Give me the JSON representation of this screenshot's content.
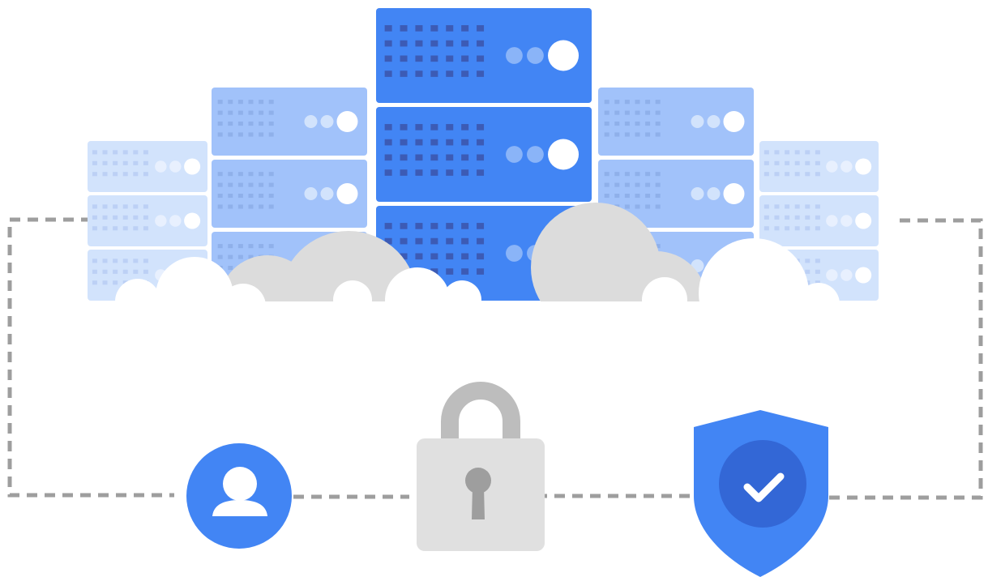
{
  "colors": {
    "background": "#ffffff",
    "server_primary": "#4285f4",
    "server_primary_dot": "#3c5bb5",
    "server_primary_led": "#8ab4f8",
    "server_mid": "#a1c2fa",
    "server_mid_dot": "#8fb0ea",
    "server_mid_led": "#d2e3fc",
    "server_light": "#d2e3fc",
    "server_light_dot": "#bcd0f5",
    "server_light_led": "#e8f0fe",
    "cloud": "#dcdcdc",
    "cloud_white": "#ffffff",
    "connector": "#9e9e9e",
    "lock_body": "#e0e0e0",
    "lock_shackle": "#bdbdbd",
    "keyhole": "#9e9e9e",
    "user_badge": "#4285f4",
    "shield": "#4285f4",
    "shield_inner": "#3367d6",
    "check": "#ffffff"
  },
  "icons": {
    "user": "user-avatar-icon",
    "lock": "padlock-icon",
    "shield": "shield-check-icon",
    "servers": "server-rack-icon",
    "clouds": "cloud-icon"
  },
  "diagram": {
    "server_stacks": [
      {
        "tier": "light",
        "units": 3
      },
      {
        "tier": "mid",
        "units": 3
      },
      {
        "tier": "primary",
        "units": 3
      },
      {
        "tier": "mid",
        "units": 3
      },
      {
        "tier": "light",
        "units": 3
      }
    ],
    "nodes": [
      "user",
      "lock",
      "shield"
    ],
    "connections": [
      {
        "from": "user",
        "to": "lock",
        "style": "dashed"
      },
      {
        "from": "lock",
        "to": "shield",
        "style": "dashed"
      },
      {
        "from": "user",
        "to": "servers",
        "style": "dashed"
      },
      {
        "from": "shield",
        "to": "servers",
        "style": "dashed"
      }
    ]
  }
}
